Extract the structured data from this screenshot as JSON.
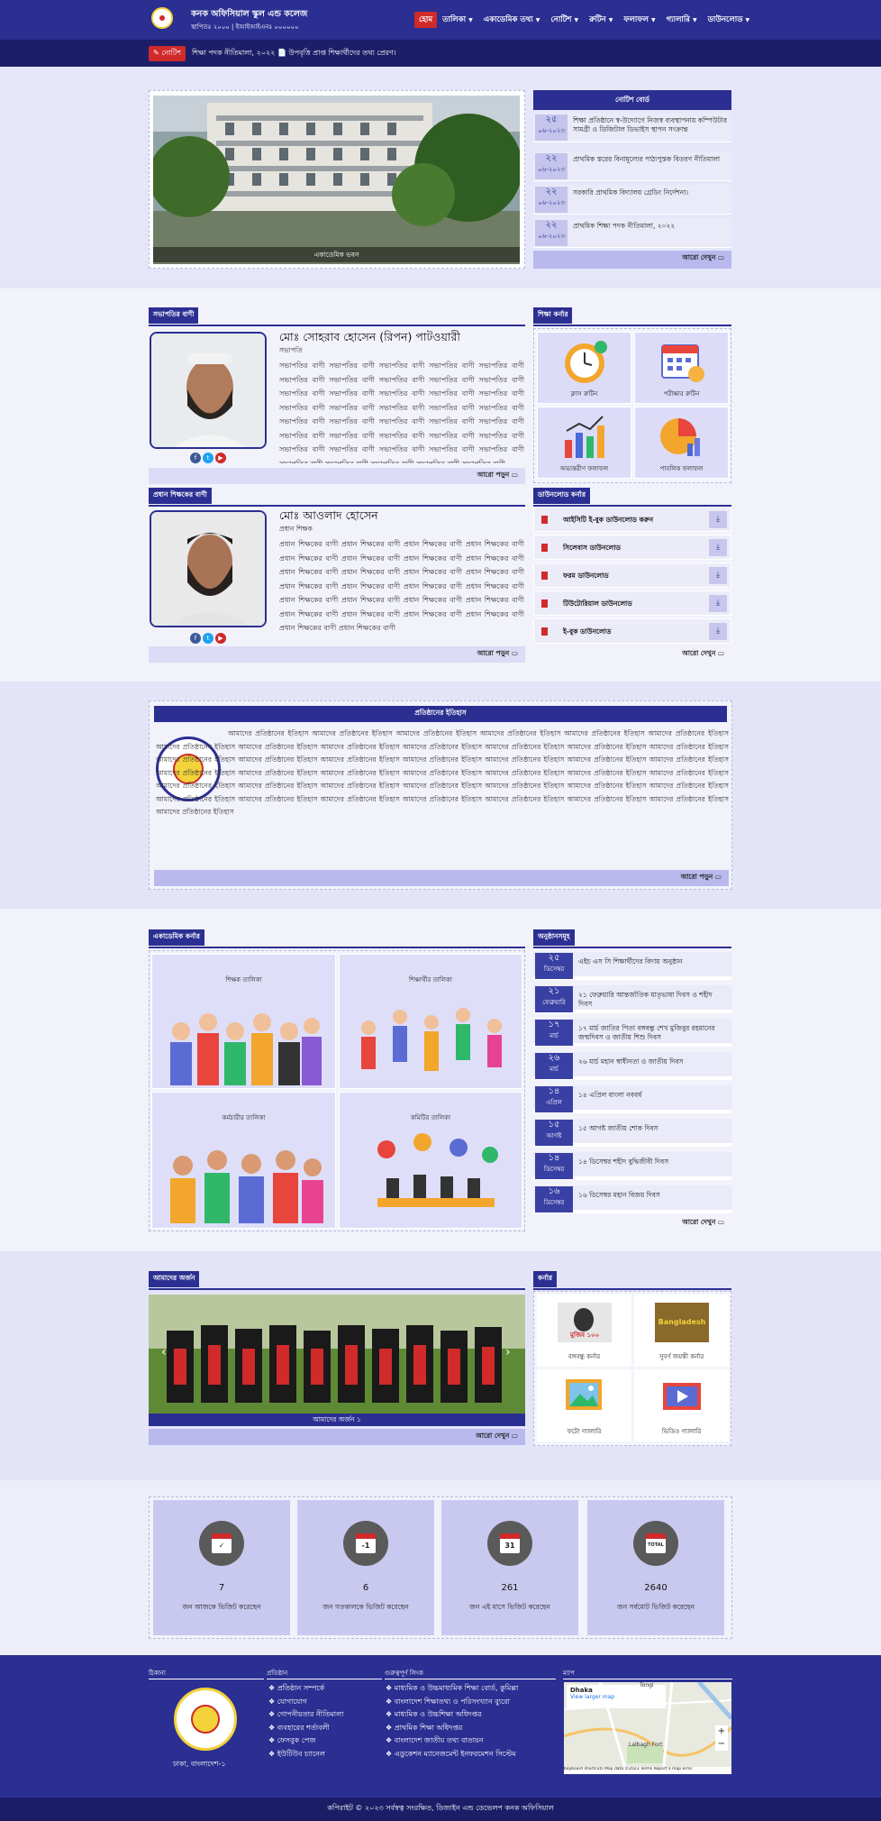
{
  "header": {
    "site_name": "কনক অফিসিয়াল স্কুল এন্ড কলেজ",
    "site_sub": "স্থাপিতঃ ২০০০ | ইআইআইএনঃ ০০০০০০",
    "nav": [
      "হোম",
      "তালিকা",
      "একাডেমিক তথ্য",
      "নোটিশ",
      "রুটিন",
      "ফলাফল",
      "গ্যালারি",
      "ডাউনলোড"
    ]
  },
  "ticker": {
    "label": "নোটিশ",
    "text": "শিক্ষা পদক নীতিমালা, ২০২২  📄  উপবৃত্তি প্রাপ্ত শিক্ষার্থীদের তথ্য প্রেরণ।"
  },
  "slider": {
    "caption": "একাডেমিক ভবন"
  },
  "notice_board": {
    "title": "নোটিশ বোর্ড",
    "more": "আরো দেখুন",
    "items": [
      {
        "day": "২৫",
        "month": "০৬-২০২৩",
        "text": "শিক্ষা প্রতিষ্ঠানে স্ব-উদ্যোগে নিজস্ব ব্যবস্থাপনায় কম্পিউটার সামগ্রী ও ডিজিটাল ডিভাইস স্থাপন সংক্রান্ত"
      },
      {
        "day": "২২",
        "month": "০৬-২০২৩",
        "text": "প্রাথমিক স্তরের বিনামূল্যের পাঠ্যপুস্তক বিতরণ নীতিমালা"
      },
      {
        "day": "২২",
        "month": "০৬-২০২৩",
        "text": "সরকারি প্রাথমিক বিদ্যালয় গ্রেডিং নির্দেশনা।"
      },
      {
        "day": "২২",
        "month": "০৬-২০২৩",
        "text": "প্রাথমিক শিক্ষা পদক নীতিমালা, ২০২২"
      }
    ]
  },
  "president": {
    "section": "সভাপতির বাণী",
    "name": "মোঃ সোহরাব হোসেন (রিপন) পাটওয়ারী",
    "role": "সভাপতি",
    "body": "সভাপতির বাণী সভাপতির বাণী সভাপতির বাণী সভাপতির বাণী সভাপতির বাণী সভাপতির বাণী সভাপতির বাণী সভাপতির বাণী সভাপতির বাণী সভাপতির বাণী সভাপতির বাণী সভাপতির বাণী সভাপতির বাণী সভাপতির বাণী সভাপতির বাণী সভাপতির বাণী সভাপতির বাণী সভাপতির বাণী সভাপতির বাণী সভাপতির বাণী সভাপতির বাণী সভাপতির বাণী সভাপতির বাণী সভাপতির বাণী সভাপতির বাণী সভাপতির বাণী সভাপতির বাণী সভাপতির বাণী সভাপতির বাণী সভাপতির বাণী সভাপতির বাণী সভাপতির বাণী সভাপতির বাণী সভাপতির বাণী সভাপতির বাণী সভাপতির বাণী সভাপতির বাণী সভাপতির বাণী সভাপতির বাণী সভাপতির বাণী",
    "more": "আরো পড়ুন"
  },
  "headmaster": {
    "section": "প্রধান শিক্ষকের বাণী",
    "name": "মোঃ আওলাদ হোসেন",
    "role": "প্রধান শিক্ষক",
    "body": "প্রধান শিক্ষকের বাণী প্রধান শিক্ষকের বাণী প্রধান শিক্ষকের বাণী প্রধান শিক্ষকের বাণী প্রধান শিক্ষকের বাণী প্রধান শিক্ষকের বাণী প্রধান শিক্ষকের বাণী প্রধান শিক্ষকের বাণী প্রধান শিক্ষকের বাণী প্রধান শিক্ষকের বাণী প্রধান শিক্ষকের বাণী প্রধান শিক্ষকের বাণী প্রধান শিক্ষকের বাণী প্রধান শিক্ষকের বাণী প্রধান শিক্ষকের বাণী প্রধান শিক্ষকের বাণী প্রধান শিক্ষকের বাণী প্রধান শিক্ষকের বাণী প্রধান শিক্ষকের বাণী প্রধান শিক্ষকের বাণী প্রধান শিক্ষকের বাণী প্রধান শিক্ষকের বাণী প্রধান শিক্ষকের বাণী প্রধান শিক্ষকের বাণী প্রধান শিক্ষকের বাণী প্রধান শিক্ষকের বাণী",
    "more": "আরো পড়ুন"
  },
  "education_corner": {
    "title": "শিক্ষা কর্নার",
    "items": [
      "ক্লাস রুটিন",
      "পরীক্ষার রুটিন",
      "অভ্যন্তরীণ ফলাফল",
      "পাবলিক ফলাফল"
    ]
  },
  "download_corner": {
    "title": "ডাউনলোড কর্নার",
    "items": [
      "আইসিটি ই-বুক ডাউনলোড করুন",
      "সিলেবাস ডাউনলোড",
      "ফরম ডাউনলোড",
      "টিউটোরিয়াল ডাউনলোড",
      "ই-বুক ডাউনলোড"
    ],
    "more": "আরো দেখুন"
  },
  "history": {
    "title": "প্রতিষ্ঠানের ইতিহাস",
    "body": "আমাদের প্রতিষ্ঠানের ইতিহাস আমাদের প্রতিষ্ঠানের ইতিহাস আমাদের প্রতিষ্ঠানের ইতিহাস আমাদের প্রতিষ্ঠানের ইতিহাস আমাদের প্রতিষ্ঠানের ইতিহাস আমাদের প্রতিষ্ঠানের ইতিহাস আমাদের প্রতিষ্ঠানের ইতিহাস আমাদের প্রতিষ্ঠানের ইতিহাস আমাদের প্রতিষ্ঠানের ইতিহাস আমাদের প্রতিষ্ঠানের ইতিহাস আমাদের প্রতিষ্ঠানের ইতিহাস আমাদের প্রতিষ্ঠানের ইতিহাস আমাদের প্রতিষ্ঠানের ইতিহাস আমাদের প্রতিষ্ঠানের ইতিহাস আমাদের প্রতিষ্ঠানের ইতিহাস আমাদের প্রতিষ্ঠানের ইতিহাস আমাদের প্রতিষ্ঠানের ইতিহাস আমাদের প্রতিষ্ঠানের ইতিহাস আমাদের প্রতিষ্ঠানের ইতিহাস আমাদের প্রতিষ্ঠানের ইতিহাস আমাদের প্রতিষ্ঠানের ইতিহাস আমাদের প্রতিষ্ঠানের ইতিহাস আমাদের প্রতিষ্ঠানের ইতিহাস আমাদের প্রতিষ্ঠানের ইতিহাস আমাদের প্রতিষ্ঠানের ইতিহাস আমাদের প্রতিষ্ঠানের ইতিহাস আমাদের প্রতিষ্ঠানের ইতিহাস আমাদের প্রতিষ্ঠানের ইতিহাস আমাদের প্রতিষ্ঠানের ইতিহাস আমাদের প্রতিষ্ঠানের ইতিহাস আমাদের প্রতিষ্ঠানের ইতিহাস আমাদের প্রতিষ্ঠানের ইতিহাস আমাদের প্রতিষ্ঠানের ইতিহাস আমাদের প্রতিষ্ঠানের ইতিহাস আমাদের প্রতিষ্ঠানের ইতিহাস আমাদের প্রতিষ্ঠানের ইতিহাস আমাদের প্রতিষ্ঠানের ইতিহাস আমাদের প্রতিষ্ঠানের ইতিহাস আমাদের প্রতিষ্ঠানের ইতিহাস আমাদের প্রতিষ্ঠানের ইতিহাস আমাদের প্রতিষ্ঠানের ইতিহাস আমাদের প্রতিষ্ঠানের ইতিহাস",
    "more": "আরো পড়ুন"
  },
  "academic_corner": {
    "title": "একাডেমিক কর্নার",
    "items": [
      "শিক্ষক তালিকা",
      "শিক্ষার্থীর তালিকা",
      "কর্মচারীর তালিকা",
      "কমিটির তালিকা"
    ]
  },
  "events": {
    "title": "অনুষ্ঠানসমূহ",
    "more": "আরো দেখুন",
    "items": [
      {
        "day": "২৫",
        "month": "ডিসেম্বর",
        "text": "এইচ এস সি শিক্ষার্থীদের বিদায় অনুষ্ঠান"
      },
      {
        "day": "২১",
        "month": "ফেব্রুয়ারি",
        "text": "২১ ফেব্রুয়ারি আন্তর্জাতিক মাতৃভাষা দিবস ও শহীদ দিবস"
      },
      {
        "day": "১৭",
        "month": "মার্চ",
        "text": "১৭ মার্চ জাতির পিতা বঙ্গবন্ধু শেখ মুজিবুর রহমানের জন্মদিবস ও জাতীয় শিশু দিবস"
      },
      {
        "day": "২৬",
        "month": "মার্চ",
        "text": "২৬ মার্চ মহান স্বাধীনতা ও জাতীয় দিবস"
      },
      {
        "day": "১৪",
        "month": "এপ্রিল",
        "text": "১৪ এপ্রিল বাংলা নববর্ষ"
      },
      {
        "day": "১৫",
        "month": "আগষ্ট",
        "text": "১৫ আগষ্ট জাতীয় শোক দিবস"
      },
      {
        "day": "১৪",
        "month": "ডিসেম্বর",
        "text": "১৪ ডিসেম্বর শহীদ বুদ্ধিজীবী দিবস"
      },
      {
        "day": "১৬",
        "month": "ডিসেম্বর",
        "text": "১৬ ডিসেম্বর মহান বিজয় দিবস"
      }
    ]
  },
  "achievement": {
    "title": "আমাদের অর্জন",
    "caption": "আমাদের অর্জন ১",
    "more": "আরো দেখুন"
  },
  "corner": {
    "title": "কর্নার",
    "items": [
      "বঙ্গবন্ধু কর্নার",
      "সুবর্ণ জয়ন্তী কর্নার",
      "ফটো গ্যালারি",
      "ভিডিও গ্যালারি"
    ],
    "badge": "মুজিব ১০০",
    "subarna": "Bangladesh"
  },
  "stats": [
    {
      "cal": "",
      "num": "7",
      "cap": "জন আজকে ভিজিট করেছেন"
    },
    {
      "cal": "-1",
      "num": "6",
      "cap": "জন গতকালকে ভিজিট করেছেন"
    },
    {
      "cal": "31",
      "num": "261",
      "cap": "জন এই মাসে ভিজিট করেছেন"
    },
    {
      "cal": "TOTAL",
      "num": "2640",
      "cap": "জন সর্বমোট ভিজিট করেছেন"
    }
  ],
  "footer": {
    "h1": "ঠিকানা",
    "h2": "প্রতিষ্ঠান",
    "h3": "গুরুত্বপূর্ণ লিংক",
    "h4": "ম্যাপ",
    "address": "ঢাকা, বাংলাদেশ-১",
    "links1": [
      "প্রতিষ্ঠান সম্পর্কে",
      "যোগাযোগ",
      "গোপনীয়তার নীতিমালা",
      "ব্যবহারের শর্তাবলী",
      "ফেসবুক পেজ",
      "ইউটিউব চ্যানেল"
    ],
    "links2": [
      "মাধ্যমিক ও উচ্চমাধ্যমিক শিক্ষা বোর্ড, কুমিল্লা",
      "বাংলাদেশ শিক্ষাতথ্য ও পরিসংখ্যান ব্যুরো",
      "মাধ্যমিক ও উচ্চশিক্ষা অধিদপ্তর",
      "প্রাথমিক শিক্ষা অধিদপ্তর",
      "বাংলাদেশ জাতীয় তথ্য বাতায়ন",
      "এডুকেশন ম্যানেজমেন্ট ইনফরমেশন সিস্টেম"
    ],
    "map": {
      "city": "Dhaka",
      "link": "View larger map",
      "tongi": "Tongi",
      "lalbagh": "Lalbagh Fort",
      "attr": "Keyboard shortcuts  Map data ©2023  Terms  Report a map error"
    }
  },
  "copyright": "কপিরাইট © ২০২৩ সর্বস্বত্ব সংরক্ষিত, ডিজাইন এন্ড ডেভেলপ কনক অফিসিয়াল",
  "colors": {
    "primary": "#2b2f92",
    "accent": "#d02a2a",
    "band": "#e9e9f9"
  }
}
